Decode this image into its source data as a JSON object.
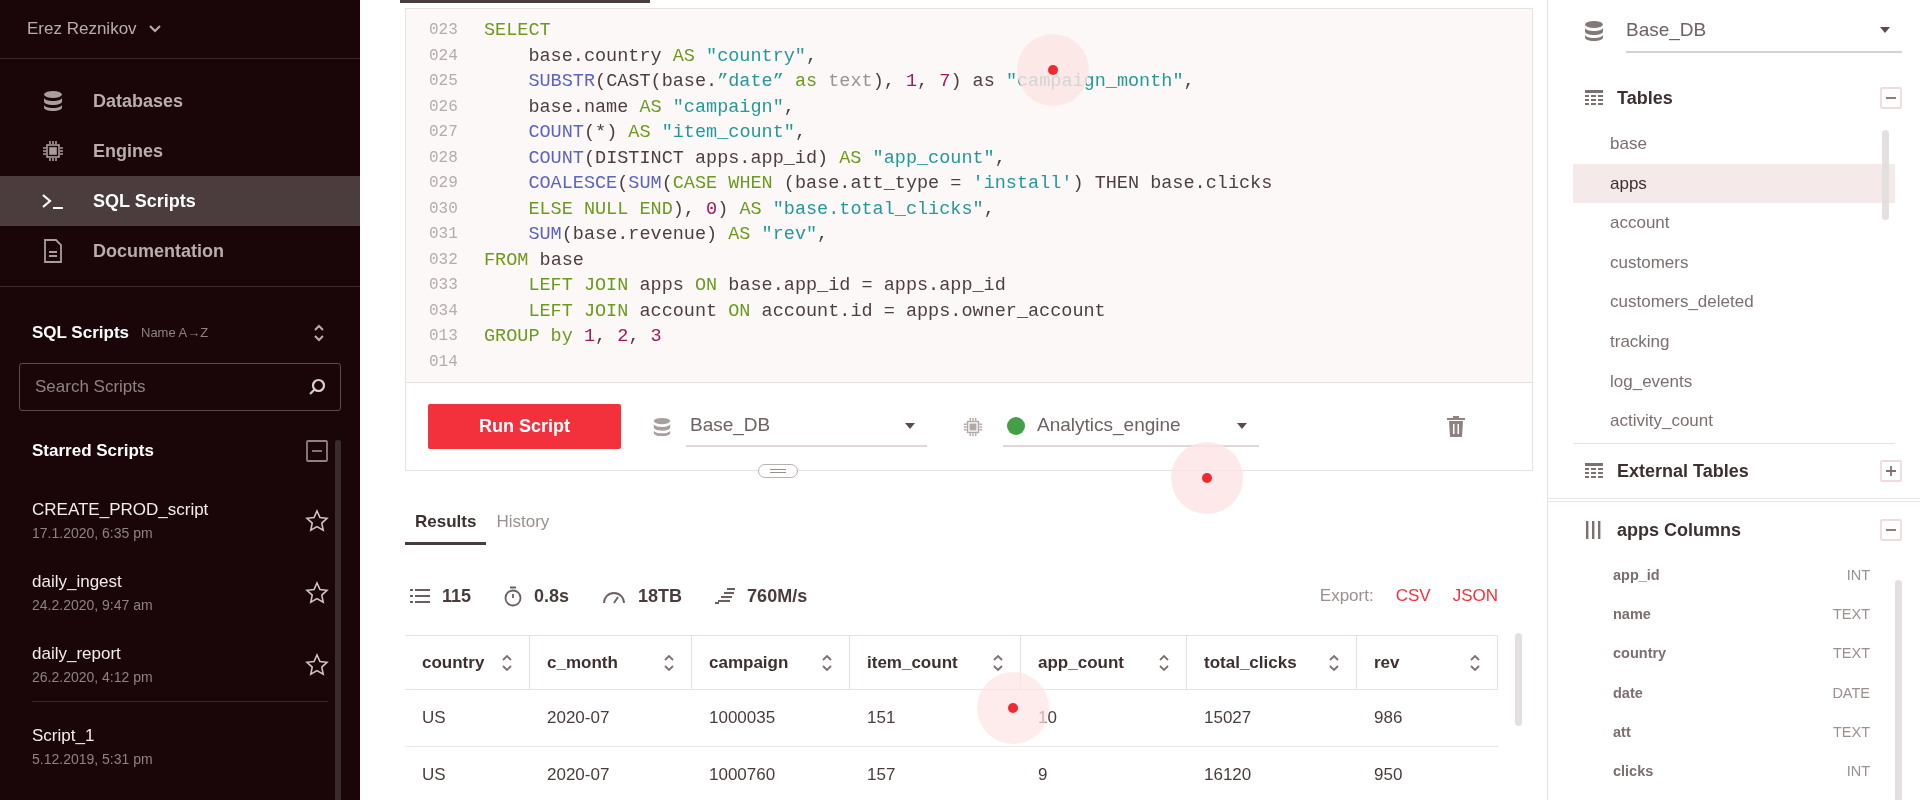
{
  "sidebar": {
    "user": {
      "name": "Erez Reznikov"
    },
    "nav": [
      {
        "label": "Databases",
        "kind": "database",
        "selected": false
      },
      {
        "label": "Engines",
        "kind": "engine",
        "selected": false
      },
      {
        "label": "SQL Scripts",
        "kind": "terminal",
        "selected": true
      },
      {
        "label": "Documentation",
        "kind": "document",
        "selected": false
      }
    ],
    "scripts_header": {
      "title": "SQL Scripts",
      "sort": "Name A→Z"
    },
    "search": {
      "placeholder": "Search Scripts"
    },
    "starred": {
      "title": "Starred Scripts",
      "expanded": true,
      "scripts": [
        {
          "name": "CREATE_PROD_script",
          "time": "17.1.2020, 6:35 pm"
        },
        {
          "name": "daily_ingest",
          "time": "24.2.2020, 9:47 am"
        },
        {
          "name": "daily_report",
          "time": "26.2.2020, 4:12 pm"
        }
      ]
    },
    "other_scripts": [
      {
        "name": "Script_1",
        "time": "5.12.2019, 5:31 pm"
      }
    ]
  },
  "editor": {
    "lines": [
      {
        "number": "023",
        "tokens": [
          {
            "kind": "keyword",
            "text": "SELECT"
          }
        ]
      },
      {
        "number": "024",
        "tokens": [
          {
            "kind": "plain",
            "text": "    base.country "
          },
          {
            "kind": "keyword",
            "text": "AS"
          },
          {
            "kind": "string",
            "text": " \"country\""
          },
          {
            "kind": "plain",
            "text": ","
          }
        ]
      },
      {
        "number": "025",
        "tokens": [
          {
            "kind": "function",
            "text": "    SUBSTR"
          },
          {
            "kind": "plain",
            "text": "(CAST(base."
          },
          {
            "kind": "string",
            "text": "”date”"
          },
          {
            "kind": "keyword",
            "text": " as "
          },
          {
            "kind": "dim",
            "text": "text"
          },
          {
            "kind": "plain",
            "text": "), "
          },
          {
            "kind": "number",
            "text": "1"
          },
          {
            "kind": "plain",
            "text": ", "
          },
          {
            "kind": "number",
            "text": "7"
          },
          {
            "kind": "plain",
            "text": ") as "
          },
          {
            "kind": "string",
            "text": "\"campaign_month\""
          },
          {
            "kind": "plain",
            "text": ","
          }
        ]
      },
      {
        "number": "026",
        "tokens": [
          {
            "kind": "plain",
            "text": "    base.name "
          },
          {
            "kind": "keyword",
            "text": "AS"
          },
          {
            "kind": "string",
            "text": " \"campaign\""
          },
          {
            "kind": "plain",
            "text": ","
          }
        ]
      },
      {
        "number": "027",
        "tokens": [
          {
            "kind": "function",
            "text": "    COUNT"
          },
          {
            "kind": "plain",
            "text": "(*) "
          },
          {
            "kind": "keyword",
            "text": "AS"
          },
          {
            "kind": "string",
            "text": " \"item_count\""
          },
          {
            "kind": "plain",
            "text": ","
          }
        ]
      },
      {
        "number": "028",
        "tokens": [
          {
            "kind": "function",
            "text": "    COUNT"
          },
          {
            "kind": "plain",
            "text": "(DISTINCT apps.app_id) "
          },
          {
            "kind": "keyword",
            "text": "AS"
          },
          {
            "kind": "string",
            "text": " \"app_count\""
          },
          {
            "kind": "plain",
            "text": ","
          }
        ]
      },
      {
        "number": "029",
        "tokens": [
          {
            "kind": "function",
            "text": "    COALESCE"
          },
          {
            "kind": "plain",
            "text": "("
          },
          {
            "kind": "function",
            "text": "SUM"
          },
          {
            "kind": "plain",
            "text": "("
          },
          {
            "kind": "keyword",
            "text": "CASE WHEN"
          },
          {
            "kind": "plain",
            "text": " (base.att_type = "
          },
          {
            "kind": "string",
            "text": "'install'"
          },
          {
            "kind": "plain",
            "text": ") THEN base.clicks"
          }
        ]
      },
      {
        "number": "030",
        "tokens": [
          {
            "kind": "keyword",
            "text": "    ELSE NULL END"
          },
          {
            "kind": "plain",
            "text": "), "
          },
          {
            "kind": "number",
            "text": "0"
          },
          {
            "kind": "plain",
            "text": ") "
          },
          {
            "kind": "keyword",
            "text": "AS"
          },
          {
            "kind": "string",
            "text": " \"base.total_clicks\""
          },
          {
            "kind": "plain",
            "text": ","
          }
        ]
      },
      {
        "number": "031",
        "tokens": [
          {
            "kind": "function",
            "text": "    SUM"
          },
          {
            "kind": "plain",
            "text": "(base.revenue) "
          },
          {
            "kind": "keyword",
            "text": "AS"
          },
          {
            "kind": "string",
            "text": " \"rev\""
          },
          {
            "kind": "plain",
            "text": ","
          }
        ]
      },
      {
        "number": "032",
        "tokens": [
          {
            "kind": "keyword",
            "text": "FROM"
          },
          {
            "kind": "plain",
            "text": " base"
          }
        ]
      },
      {
        "number": "033",
        "tokens": [
          {
            "kind": "keyword",
            "text": "    LEFT JOIN"
          },
          {
            "kind": "plain",
            "text": " apps "
          },
          {
            "kind": "keyword",
            "text": "ON"
          },
          {
            "kind": "plain",
            "text": " base.app_id = apps.app_id"
          }
        ]
      },
      {
        "number": "034",
        "tokens": [
          {
            "kind": "keyword",
            "text": "    LEFT JOIN"
          },
          {
            "kind": "plain",
            "text": " account "
          },
          {
            "kind": "keyword",
            "text": "ON"
          },
          {
            "kind": "plain",
            "text": " account.id = apps.owner_account"
          }
        ]
      },
      {
        "number": "013",
        "tokens": [
          {
            "kind": "keyword",
            "text": "GROUP by"
          },
          {
            "kind": "number",
            "text": " 1"
          },
          {
            "kind": "plain",
            "text": ", "
          },
          {
            "kind": "number",
            "text": "2"
          },
          {
            "kind": "plain",
            "text": ", "
          },
          {
            "kind": "number",
            "text": "3"
          }
        ]
      },
      {
        "number": "014"
      }
    ]
  },
  "toolbar": {
    "run_button": "Run Script",
    "database": "Base_DB",
    "engine": {
      "name": "Analytics_engine",
      "color": "#43a047"
    }
  },
  "results": {
    "tabs": [
      {
        "label": "Results",
        "selected": true
      },
      {
        "label": "History",
        "selected": false
      }
    ],
    "stats": [
      {
        "kind": "rows",
        "text": "115"
      },
      {
        "kind": "time",
        "text": "0.8s"
      },
      {
        "kind": "size",
        "text": "18TB"
      },
      {
        "kind": "speed",
        "text": "760M/s"
      }
    ],
    "export": {
      "label": "Export:",
      "formats": [
        "CSV",
        "JSON"
      ]
    },
    "table": {
      "columns": [
        "country",
        "c_month",
        "campaign",
        "item_count",
        "app_count",
        "total_clicks",
        "rev"
      ],
      "rows": [
        [
          "US",
          "2020-07",
          "1000035",
          "151",
          "10",
          "15027",
          "986"
        ],
        [
          "US",
          "2020-07",
          "1000760",
          "157",
          "9",
          "16120",
          "950"
        ]
      ]
    }
  },
  "schema": {
    "database": "Base_DB",
    "tables": {
      "title": "Tables",
      "expanded": true,
      "items": [
        {
          "label": "base",
          "selected": false
        },
        {
          "label": "apps",
          "selected": true
        },
        {
          "label": "account",
          "selected": false
        },
        {
          "label": "customers",
          "selected": false
        },
        {
          "label": "customers_deleted",
          "selected": false
        },
        {
          "label": "tracking",
          "selected": false
        },
        {
          "label": "log_events",
          "selected": false
        },
        {
          "label": "activity_count",
          "selected": false
        }
      ]
    },
    "external_tables": {
      "title": "External Tables",
      "expanded": false
    },
    "columns": {
      "title": "apps Columns",
      "expanded": true,
      "items": [
        {
          "name": "app_id",
          "type": "INT"
        },
        {
          "name": "name",
          "type": "TEXT"
        },
        {
          "name": "country",
          "type": "TEXT"
        },
        {
          "name": "date",
          "type": "DATE"
        },
        {
          "name": "att",
          "type": "TEXT"
        },
        {
          "name": "clicks",
          "type": "INT"
        }
      ]
    }
  }
}
